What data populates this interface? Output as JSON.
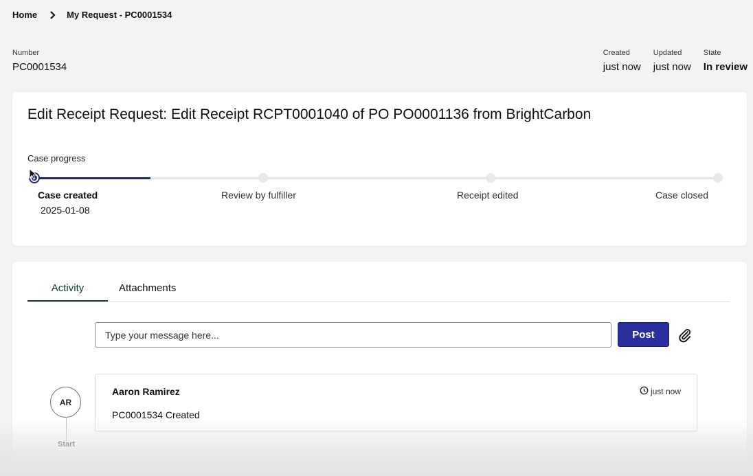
{
  "breadcrumb": {
    "home": "Home",
    "current": "My Request - PC0001534"
  },
  "record": {
    "number_label": "Number",
    "number_value": "PC0001534",
    "created_label": "Created",
    "created_value": "just now",
    "updated_label": "Updated",
    "updated_value": "just now",
    "state_label": "State",
    "state_value": "In review"
  },
  "case": {
    "title": "Edit Receipt Request: Edit Receipt RCPT0001040 of PO PO0001136 from BrightCarbon",
    "progress_label": "Case progress",
    "progress_fraction": 0.17,
    "steps": [
      {
        "label": "Case created",
        "date": "2025-01-08",
        "state": "done"
      },
      {
        "label": "Review by fulfiller",
        "date": "",
        "state": "pending"
      },
      {
        "label": "Receipt edited",
        "date": "",
        "state": "pending"
      },
      {
        "label": "Case closed",
        "date": "",
        "state": "pending"
      }
    ]
  },
  "activity": {
    "tabs": [
      "Activity",
      "Attachments"
    ],
    "active_tab": "Activity",
    "compose_placeholder": "Type your message here...",
    "post_label": "Post",
    "entries": [
      {
        "initials": "AR",
        "author": "Aaron Ramirez",
        "time": "just now",
        "text": "PC0001534 Created"
      }
    ],
    "start_label": "Start"
  },
  "colors": {
    "accent": "#2b2f9e",
    "progress": "#1f2a6e",
    "tab_underline": "#1d3a2f"
  }
}
